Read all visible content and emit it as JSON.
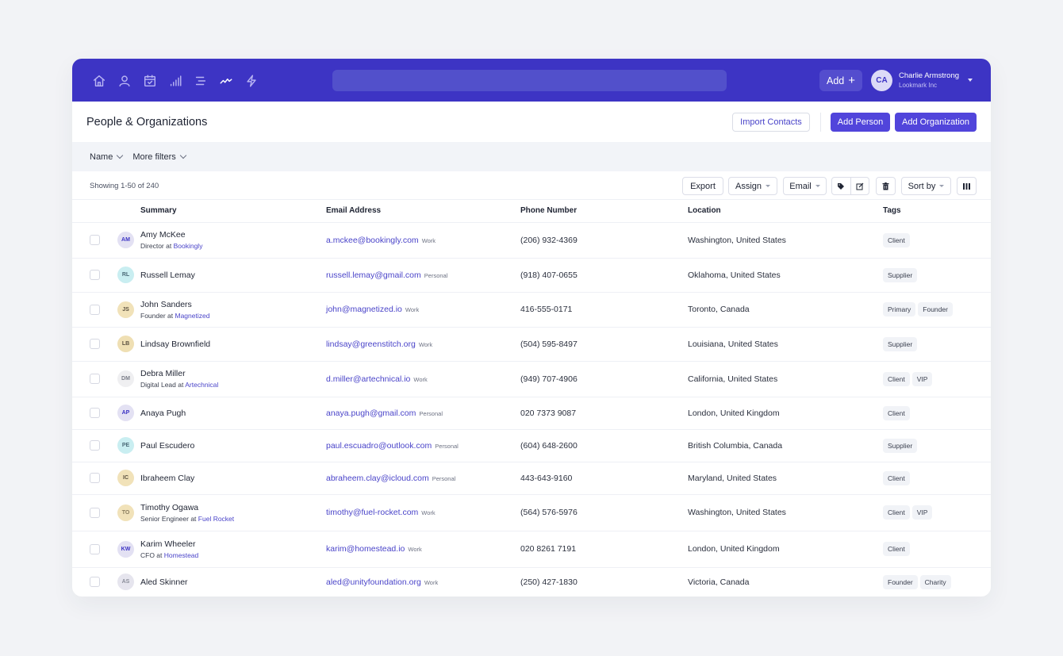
{
  "topbar": {
    "nav_icons": [
      "home-icon",
      "person-icon",
      "calendar-icon",
      "bar-chart-icon",
      "list-icon",
      "activity-icon",
      "lightning-icon"
    ],
    "search_placeholder": "",
    "add_label": "Add",
    "add_icon": "+",
    "user": {
      "initials": "CA",
      "name": "Charlie Armstrong",
      "org": "Lookmark Inc"
    }
  },
  "page": {
    "title": "People & Organizations",
    "import_label": "Import Contacts",
    "add_person_label": "Add Person",
    "add_org_label": "Add Organization"
  },
  "filters": [
    {
      "label": "Name"
    },
    {
      "label": "More filters"
    }
  ],
  "toolbar": {
    "showing": "Showing 1-50 of 240",
    "export_label": "Export",
    "assign_label": "Assign",
    "email_label": "Email",
    "sort_label": "Sort by"
  },
  "table": {
    "columns": [
      "Summary",
      "Email Address",
      "Phone Number",
      "Location",
      "Tags"
    ],
    "rows": [
      {
        "initials": "AM",
        "avatar_bg": "#e3e1f3",
        "avatar_fg": "#3d34c4",
        "name": "Amy McKee",
        "role": "Director at",
        "company": "Bookingly",
        "email": "a.mckee@bookingly.com",
        "email_type": "Work",
        "phone": "(206) 932-4369",
        "location": "Washington, United States",
        "tags": [
          "Client"
        ]
      },
      {
        "initials": "RL",
        "avatar_bg": "#c9eef1",
        "avatar_fg": "#4b6b78",
        "name": "Russell Lemay",
        "role": "",
        "company": "",
        "email": "russell.lemay@gmail.com",
        "email_type": "Personal",
        "phone": "(918) 407-0655",
        "location": "Oklahoma, United States",
        "tags": [
          "Supplier"
        ]
      },
      {
        "initials": "JS",
        "avatar_bg": "#f1e2b9",
        "avatar_fg": "#5b5140",
        "name": "John Sanders",
        "role": "Founder at",
        "company": "Magnetized",
        "email": "john@magnetized.io",
        "email_type": "Work",
        "phone": "416-555-0171",
        "location": "Toronto, Canada",
        "tags": [
          "Primary",
          "Founder"
        ]
      },
      {
        "initials": "LB",
        "avatar_bg": "#efdfb3",
        "avatar_fg": "#5b5140",
        "name": "Lindsay Brownfield",
        "role": "",
        "company": "",
        "email": "lindsay@greenstitch.org",
        "email_type": "Work",
        "phone": "(504) 595-8497",
        "location": "Louisiana, United States",
        "tags": [
          "Supplier"
        ]
      },
      {
        "initials": "DM",
        "avatar_bg": "#efeff1",
        "avatar_fg": "#7a7d88",
        "name": "Debra Miller",
        "role": "Digital Lead at",
        "company": "Artechnical",
        "email": "d.miller@artechnical.io",
        "email_type": "Work",
        "phone": "(949) 707-4906",
        "location": "California, United States",
        "tags": [
          "Client",
          "VIP"
        ]
      },
      {
        "initials": "AP",
        "avatar_bg": "#e3e1f3",
        "avatar_fg": "#3d34c4",
        "name": "Anaya Pugh",
        "role": "",
        "company": "",
        "email": "anaya.pugh@gmail.com",
        "email_type": "Personal",
        "phone": "020 7373 9087",
        "location": "London, United Kingdom",
        "tags": [
          "Client"
        ]
      },
      {
        "initials": "PE",
        "avatar_bg": "#c9eef1",
        "avatar_fg": "#4b6b78",
        "name": "Paul Escudero",
        "role": "",
        "company": "",
        "email": "paul.escuadro@outlook.com",
        "email_type": "Personal",
        "phone": "(604) 648-2600",
        "location": "British Columbia, Canada",
        "tags": [
          "Supplier"
        ]
      },
      {
        "initials": "IC",
        "avatar_bg": "#f1e2b9",
        "avatar_fg": "#5b5140",
        "name": "Ibraheem Clay",
        "role": "",
        "company": "",
        "email": "abraheem.clay@icloud.com",
        "email_type": "Personal",
        "phone": "443-643-9160",
        "location": "Maryland, United States",
        "tags": [
          "Client"
        ]
      },
      {
        "initials": "TO",
        "avatar_bg": "#f1e2b9",
        "avatar_fg": "#8a7d5e",
        "name": "Timothy Ogawa",
        "role": "Senior Engineer at",
        "company": "Fuel Rocket",
        "email": "timothy@fuel-rocket.com",
        "email_type": "Work",
        "phone": "(564) 576-5976",
        "location": "Washington, United States",
        "tags": [
          "Client",
          "VIP"
        ]
      },
      {
        "initials": "KW",
        "avatar_bg": "#e3e1f3",
        "avatar_fg": "#3d34c4",
        "name": "Karim Wheeler",
        "role": "CFO at",
        "company": "Homestead",
        "email": "karim@homestead.io",
        "email_type": "Work",
        "phone": "020 8261 7191",
        "location": "London, United Kingdom",
        "tags": [
          "Client"
        ]
      },
      {
        "initials": "AS",
        "avatar_bg": "#e6e5ee",
        "avatar_fg": "#8a8d99",
        "name": "Aled Skinner",
        "role": "",
        "company": "",
        "email": "aled@unityfoundation.org",
        "email_type": "Work",
        "phone": "(250) 427-1830",
        "location": "Victoria, Canada",
        "tags": [
          "Founder",
          "Charity"
        ]
      }
    ]
  },
  "colors": {
    "brand": "#3d34c4",
    "primary_button": "#5145db",
    "link": "#4a44c9"
  }
}
